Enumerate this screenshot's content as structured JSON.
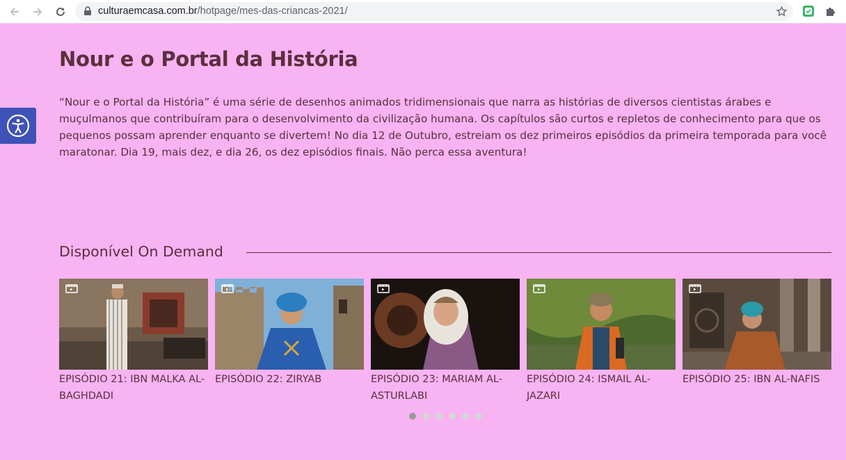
{
  "browser": {
    "url_host": "culturaemcasa.com.br",
    "url_path": "/hotpage/mes-das-criancas-2021/"
  },
  "page": {
    "title": "Nour e o Portal da História",
    "description": "“Nour e o Portal da História” é uma série de desenhos animados tridimensionais que narra as histórias de diversos cientistas árabes e muçulmanos que contribuíram para o desenvolvimento da civilização humana. Os capítulos são curtos e repletos de conhecimento para que os pequenos possam aprender enquanto se divertem! No dia 12 de Outubro, estreiam os dez primeiros episódios da primeira temporada para você maratonar. Dia 19, mais dez, e dia 26, os dez episódios finais. Não perca essa aventura!",
    "section_title": "Disponível On Demand"
  },
  "episodes": [
    {
      "title": "EPISÓDIO 21: IBN MALKA AL-BAGHDADI"
    },
    {
      "title": "EPISÓDIO 22: ZIRYAB"
    },
    {
      "title": "EPISÓDIO 23: MARIAM AL-ASTURLABI"
    },
    {
      "title": "EPISÓDIO 24: ISMAIL AL-JAZARI"
    },
    {
      "title": "EPISÓDIO 25: IBN AL-NAFIS"
    }
  ],
  "carousel": {
    "page_count": 6,
    "active_page": 1
  },
  "colors": {
    "page_background": "#f7b3f2",
    "text": "#5a2f3d",
    "accessibility_button": "#3e52b7"
  },
  "icons": {
    "back": "arrow-left-icon",
    "forward": "arrow-right-icon",
    "reload": "reload-icon",
    "lock": "lock-icon",
    "bookmark": "star-icon",
    "accessibility": "accessibility-icon",
    "video": "video-icon"
  }
}
